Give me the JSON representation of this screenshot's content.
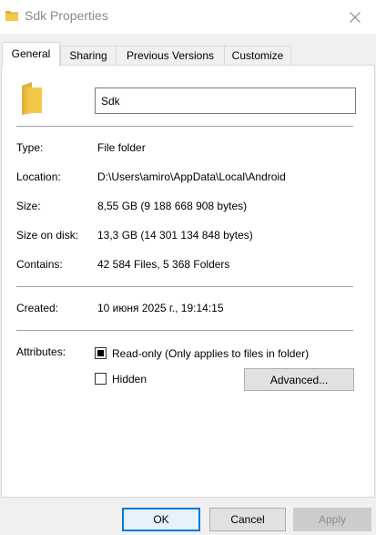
{
  "window": {
    "title": "Sdk Properties"
  },
  "tabs": [
    {
      "label": "General"
    },
    {
      "label": "Sharing"
    },
    {
      "label": "Previous Versions"
    },
    {
      "label": "Customize"
    }
  ],
  "general": {
    "name_value": "Sdk",
    "rows": {
      "type": {
        "label": "Type:",
        "value": "File folder"
      },
      "location": {
        "label": "Location:",
        "value": "D:\\Users\\amiro\\AppData\\Local\\Android"
      },
      "size": {
        "label": "Size:",
        "value": "8,55 GB (9 188 668 908 bytes)"
      },
      "size_on_disk": {
        "label": "Size on disk:",
        "value": "13,3 GB (14 301 134 848 bytes)"
      },
      "contains": {
        "label": "Contains:",
        "value": "42 584 Files, 5 368 Folders"
      },
      "created": {
        "label": "Created:",
        "value": "10 июня 2025 г., 19:14:15"
      }
    },
    "attributes": {
      "label": "Attributes:",
      "readonly_label": "Read-only (Only applies to files in folder)",
      "readonly_checked": true,
      "hidden_label": "Hidden",
      "hidden_checked": false,
      "advanced_label": "Advanced..."
    }
  },
  "buttons": {
    "ok": "OK",
    "cancel": "Cancel",
    "apply": "Apply"
  },
  "colors": {
    "folder": "#f3c84a",
    "focus": "#0078d7"
  }
}
